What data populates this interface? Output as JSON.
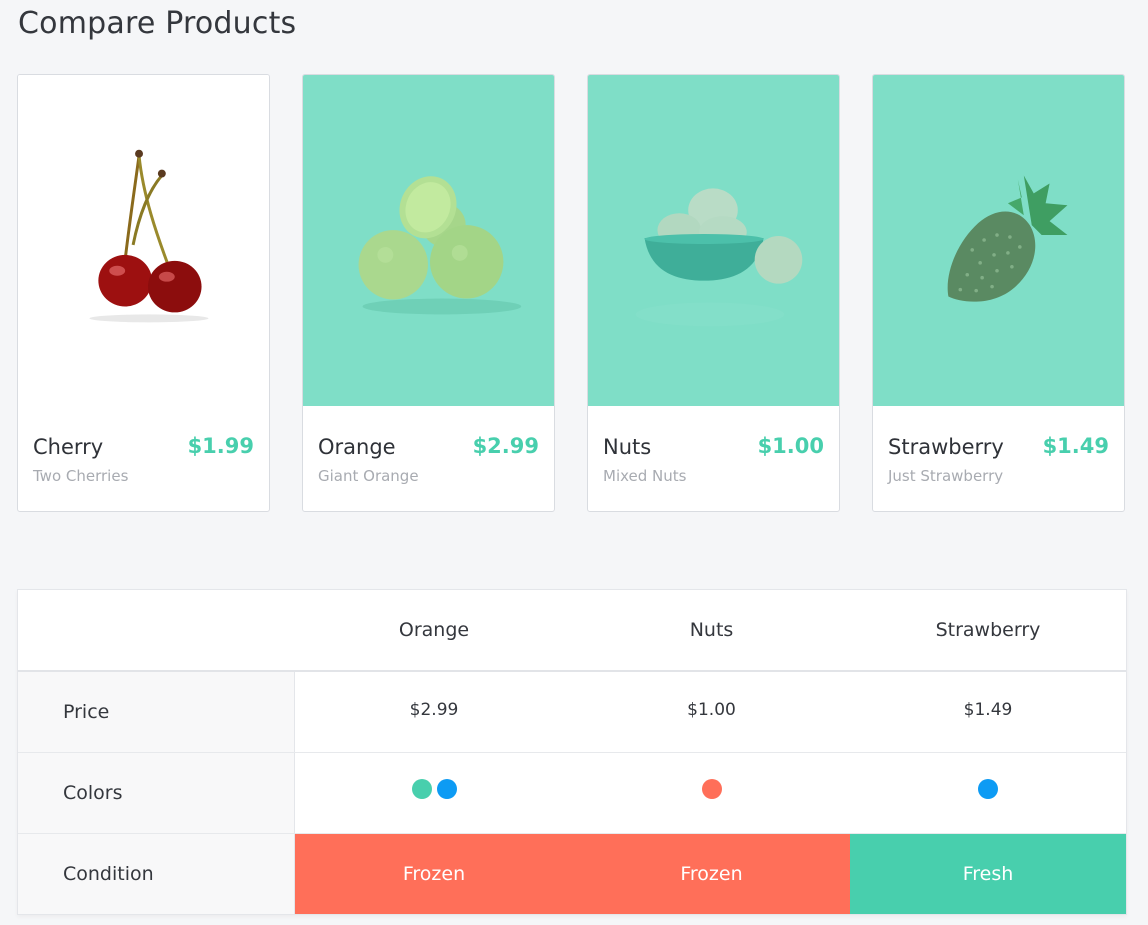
{
  "page": {
    "title": "Compare Products"
  },
  "colors": {
    "accent": "#48cfad",
    "card_image_bg": "#7fdec7",
    "frozen": "#ff6f59",
    "fresh": "#48cfad",
    "swatch_teal": "#48cfad",
    "swatch_blue": "#0d9bf4",
    "swatch_coral": "#ff6f59"
  },
  "products": [
    {
      "name": "Cherry",
      "subtitle": "Two Cherries",
      "price": "$1.99",
      "image": "cherry-image"
    },
    {
      "name": "Orange",
      "subtitle": "Giant Orange",
      "price": "$2.99",
      "image": "orange-image"
    },
    {
      "name": "Nuts",
      "subtitle": "Mixed Nuts",
      "price": "$1.00",
      "image": "nuts-image"
    },
    {
      "name": "Strawberry",
      "subtitle": "Just Strawberry",
      "price": "$1.49",
      "image": "strawberry-image"
    }
  ],
  "comparison": {
    "columns": [
      "Orange",
      "Nuts",
      "Strawberry"
    ],
    "rows": {
      "price": {
        "label": "Price",
        "values": [
          "$2.99",
          "$1.00",
          "$1.49"
        ]
      },
      "colors": {
        "label": "Colors",
        "values": [
          [
            "#48cfad",
            "#0d9bf4"
          ],
          [
            "#ff6f59"
          ],
          [
            "#0d9bf4"
          ]
        ]
      },
      "condition": {
        "label": "Condition",
        "values": [
          "Frozen",
          "Frozen",
          "Fresh"
        ]
      }
    }
  }
}
